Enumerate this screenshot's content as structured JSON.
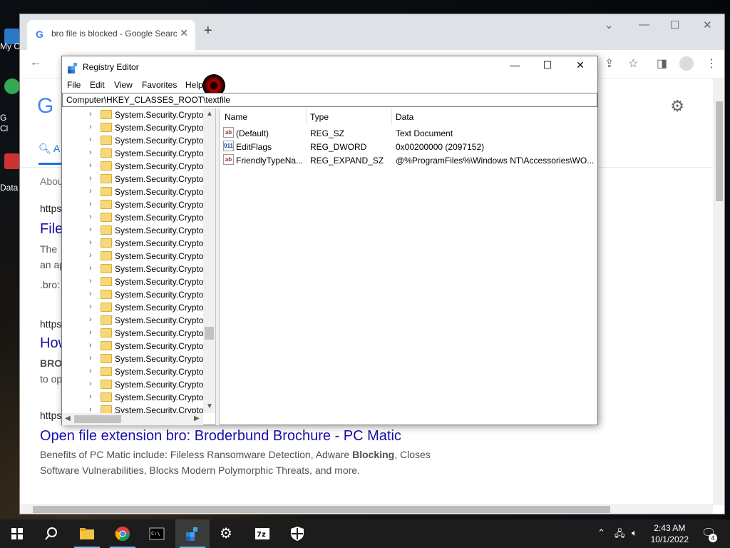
{
  "desktop": {
    "icons": [
      {
        "label": "My C"
      },
      {
        "label": "G"
      },
      {
        "label": "Cl"
      },
      {
        "label": "Data"
      }
    ]
  },
  "browser": {
    "tab_title": "bro file is blocked - Google Search",
    "new_tab_symbol": "+",
    "page": {
      "logo_partial": "G",
      "search_tab": "A",
      "about": "About",
      "results": [
        {
          "url": "https",
          "title": "File",
          "snippet_lines": [
            "The",
            "an ap",
            ".bro:"
          ]
        },
        {
          "url": "https",
          "title": "How",
          "snippet_lines": [
            "BRO",
            "to op"
          ]
        },
        {
          "url": "https",
          "title": "Open file extension bro: Broderbund Brochure - PC Matic",
          "snippet_line1_pre": "Benefits of PC Matic include: Fileless Ransomware Detection, Adware ",
          "snippet_line1_bold": "Blocking",
          "snippet_line1_post": ", Closes",
          "snippet_line2": "Software Vulnerabilities, Blocks Modern Polymorphic Threats, and more."
        }
      ]
    }
  },
  "regedit": {
    "title": "Registry Editor",
    "menu": [
      "File",
      "Edit",
      "View",
      "Favorites",
      "Help"
    ],
    "address": "Computer\\HKEY_CLASSES_ROOT\\textfile",
    "tree_items": [
      "System.Security.Crypto",
      "System.Security.Crypto",
      "System.Security.Crypto",
      "System.Security.Crypto",
      "System.Security.Crypto",
      "System.Security.Crypto",
      "System.Security.Crypto",
      "System.Security.Crypto",
      "System.Security.Crypto",
      "System.Security.Crypto",
      "System.Security.Crypto",
      "System.Security.Crypto",
      "System.Security.Crypto",
      "System.Security.Crypto",
      "System.Security.Crypto",
      "System.Security.Crypto",
      "System.Security.Crypto",
      "System.Security.Crypto",
      "System.Security.Crypto",
      "System.Security.Crypto",
      "System.Security.Crypto",
      "System.Security.Crypto",
      "System.Security.Crypto",
      "System.Security.Crypto"
    ],
    "columns": [
      "Name",
      "Type",
      "Data"
    ],
    "values": [
      {
        "icon": "ab",
        "name": "(Default)",
        "type": "REG_SZ",
        "data": "Text Document"
      },
      {
        "icon": "011",
        "name": "EditFlags",
        "type": "REG_DWORD",
        "data": "0x00200000 (2097152)"
      },
      {
        "icon": "ab",
        "name": "FriendlyTypeNa...",
        "type": "REG_EXPAND_SZ",
        "data": "@%ProgramFiles%\\Windows NT\\Accessories\\WO..."
      }
    ]
  },
  "taskbar": {
    "time": "2:43 AM",
    "date": "10/1/2022",
    "notification_count": "4",
    "apps": [
      "start-icon",
      "search-icon",
      "file-explorer-icon",
      "chrome-icon",
      "terminal-icon",
      "regedit-icon",
      "settings-icon",
      "7zip-icon",
      "defender-icon"
    ]
  }
}
